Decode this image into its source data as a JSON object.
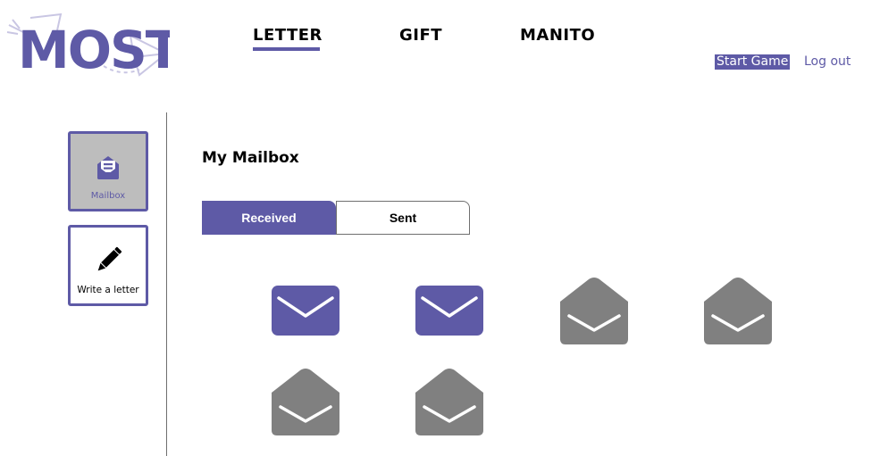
{
  "app": {
    "logo_text": "MOST"
  },
  "nav": {
    "items": [
      {
        "label": "LETTER",
        "active": true
      },
      {
        "label": "GIFT",
        "active": false
      },
      {
        "label": "MANITO",
        "active": false
      }
    ]
  },
  "header": {
    "start_game_label": "Start Game",
    "logout_label": "Log out"
  },
  "sidebar": {
    "items": [
      {
        "label": "Mailbox",
        "icon": "mailbox-icon",
        "active": true
      },
      {
        "label": "Write a letter",
        "icon": "pencil-icon",
        "active": false
      }
    ]
  },
  "main": {
    "title": "My Mailbox",
    "tabs": [
      {
        "label": "Received",
        "active": true
      },
      {
        "label": "Sent",
        "active": false
      }
    ],
    "letters": [
      {
        "status": "unread",
        "icon": "closed-envelope-icon"
      },
      {
        "status": "unread",
        "icon": "closed-envelope-icon"
      },
      {
        "status": "read",
        "icon": "open-envelope-icon"
      },
      {
        "status": "read",
        "icon": "open-envelope-icon"
      },
      {
        "status": "read",
        "icon": "open-envelope-icon"
      },
      {
        "status": "read",
        "icon": "open-envelope-icon"
      }
    ]
  },
  "colors": {
    "accent": "#5e5aa6",
    "read_letter": "#808080",
    "sidebar_active_bg": "#bdbdbd"
  }
}
